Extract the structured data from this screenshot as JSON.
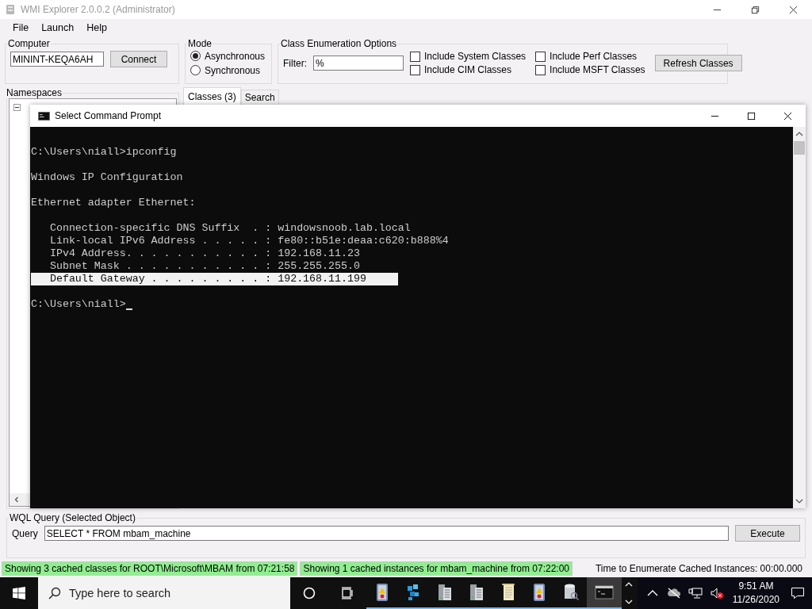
{
  "window": {
    "title": "WMI Explorer 2.0.0.2 (Administrator)"
  },
  "menu": [
    "File",
    "Launch",
    "Help"
  ],
  "computer": {
    "label": "Computer",
    "value": "MININT-KEQA6AH",
    "button": "Connect"
  },
  "mode": {
    "label": "Mode",
    "options": [
      {
        "label": "Asynchronous",
        "selected": true
      },
      {
        "label": "Synchronous",
        "selected": false
      }
    ]
  },
  "class_options": {
    "label": "Class Enumeration Options",
    "filter_label": "Filter:",
    "filter_value": "%",
    "checkboxes": [
      {
        "label": "Include System Classes",
        "checked": false
      },
      {
        "label": "Include CIM Classes",
        "checked": false
      },
      {
        "label": "Include Perf Classes",
        "checked": false
      },
      {
        "label": "Include MSFT Classes",
        "checked": false
      }
    ],
    "button": "Refresh Classes"
  },
  "namespaces": {
    "label": "Namespaces"
  },
  "tabs": [
    {
      "label": "Classes (3)",
      "selected": true
    },
    {
      "label": "Search",
      "selected": false
    }
  ],
  "console": {
    "title": "Select Command Prompt",
    "cursor": true,
    "blocks": [
      {
        "lines": [
          {
            "text": "C:\\Users\\niall>ipconfig",
            "selected": false
          }
        ]
      },
      {
        "lines": [
          {
            "text": "Windows IP Configuration",
            "selected": false
          }
        ]
      },
      {
        "lines": [
          {
            "text": "Ethernet adapter Ethernet:",
            "selected": false
          }
        ]
      },
      {
        "lines": [
          {
            "text": "   Connection-specific DNS Suffix  . : windowsnoob.lab.local",
            "selected": false
          },
          {
            "text": "   Link-local IPv6 Address . . . . . : fe80::b51e:deaa:c620:b888%4",
            "selected": false
          },
          {
            "text": "   IPv4 Address. . . . . . . . . . . : 192.168.11.23",
            "selected": false
          },
          {
            "text": "   Subnet Mask . . . . . . . . . . . : 255.255.255.0",
            "selected": false
          },
          {
            "text": "   Default Gateway . . . . . . . . . : 192.168.11.199",
            "selected": true
          }
        ]
      },
      {
        "lines": [
          {
            "text": "C:\\Users\\niall>",
            "selected": false
          }
        ]
      }
    ]
  },
  "query": {
    "label": "WQL Query (Selected Object)",
    "query_label": "Query",
    "value": "SELECT * FROM mbam_machine",
    "button": "Execute"
  },
  "status_bar": {
    "segments": [
      "Showing 3 cached classes for ROOT\\Microsoft\\MBAM from 07:21:58",
      "Showing 1 cached instances for mbam_machine from 07:22:00"
    ],
    "timing": "Time to Enumerate Cached Instances: 00:00.000"
  },
  "taskbar": {
    "search_placeholder": "Type here to search",
    "apps": [
      {
        "kind": "notebook",
        "active": false
      },
      {
        "kind": "cubes",
        "active": false
      },
      {
        "kind": "server",
        "active": false
      },
      {
        "kind": "server",
        "active": false
      },
      {
        "kind": "scroll",
        "active": false
      },
      {
        "kind": "notebook",
        "active": false
      },
      {
        "kind": "database",
        "active": false
      },
      {
        "kind": "console",
        "active": true
      }
    ],
    "time": "9:51 AM",
    "date": "11/26/2020"
  }
}
